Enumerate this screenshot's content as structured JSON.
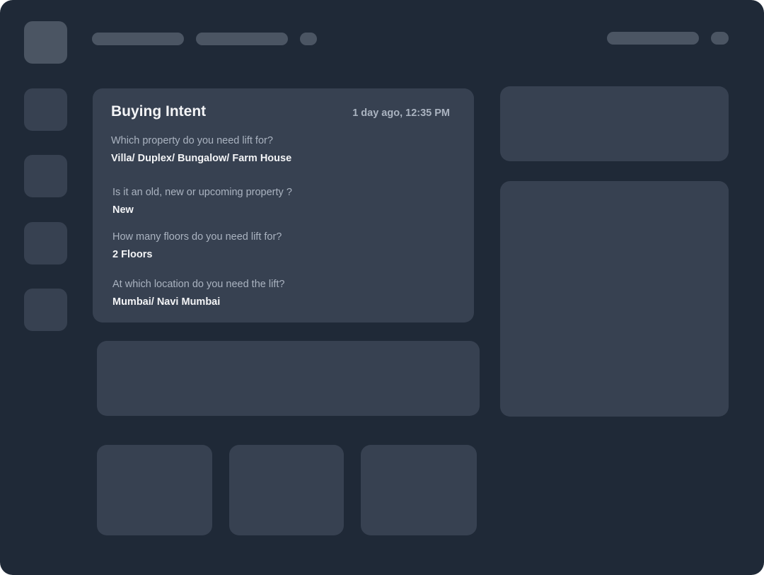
{
  "colors": {
    "background": "#1f2937",
    "panel": "#374151",
    "skeleton_light": "#4b5563",
    "text_primary": "#f3f4f6",
    "text_secondary": "#aab3c0"
  },
  "intent_card": {
    "title": "Buying Intent",
    "timestamp": "1 day ago, 12:35 PM",
    "questions": [
      {
        "question": "Which property do you need lift for?",
        "answer": "Villa/ Duplex/ Bungalow/ Farm House"
      },
      {
        "question": "Is it an old, new or upcoming property ?",
        "answer": "New"
      },
      {
        "question": "How many floors do you need lift for?",
        "answer": "2 Floors"
      },
      {
        "question": "At which location do you need the lift?",
        "answer": "Mumbai/ Navi Mumbai"
      }
    ]
  }
}
